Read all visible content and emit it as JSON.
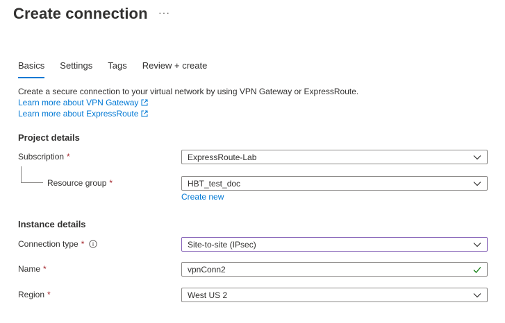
{
  "header": {
    "title": "Create connection",
    "more": "···"
  },
  "tabs": [
    {
      "label": "Basics",
      "active": true
    },
    {
      "label": "Settings",
      "active": false
    },
    {
      "label": "Tags",
      "active": false
    },
    {
      "label": "Review + create",
      "active": false
    }
  ],
  "intro": {
    "description": "Create a secure connection to your virtual network by using VPN Gateway or ExpressRoute.",
    "link_vpn": "Learn more about VPN Gateway",
    "link_er": "Learn more about ExpressRoute"
  },
  "project": {
    "heading": "Project details",
    "subscription": {
      "label": "Subscription",
      "required": "*",
      "value": "ExpressRoute-Lab"
    },
    "resource_group": {
      "label": "Resource group",
      "required": "*",
      "value": "HBT_test_doc",
      "create_new": "Create new"
    }
  },
  "instance": {
    "heading": "Instance details",
    "connection_type": {
      "label": "Connection type",
      "required": "*",
      "value": "Site-to-site (IPsec)"
    },
    "name": {
      "label": "Name",
      "required": "*",
      "value": "vpnConn2"
    },
    "region": {
      "label": "Region",
      "required": "*",
      "value": "West US 2"
    }
  },
  "colors": {
    "accent": "#0078d4",
    "required": "#a4262c",
    "valid": "#107c10",
    "focus": "#8764b8"
  },
  "icons": [
    "ellipsis-icon",
    "external-link-icon",
    "info-icon",
    "chevron-down-icon",
    "checkmark-icon"
  ]
}
